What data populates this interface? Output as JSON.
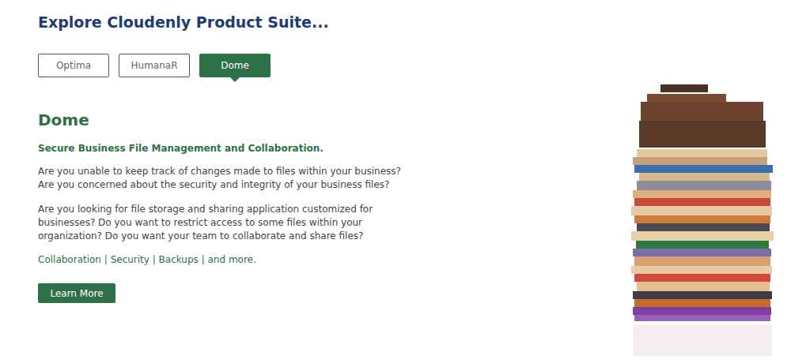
{
  "section": {
    "heading": "Explore Cloudenly Product Suite..."
  },
  "tabs": [
    {
      "label": "Optima",
      "selected": false
    },
    {
      "label": "HumanaR",
      "selected": false
    },
    {
      "label": "Dome",
      "selected": true
    }
  ],
  "product": {
    "title": "Dome",
    "subtitle": "Secure Business File Management and Collaboration.",
    "paragraphs": [
      "Are you unable to keep track of changes made to files within your business? Are you concerned about the security and integrity of your business files?",
      "Are you looking for file storage and sharing application customized for businesses? Do you want to restrict access to some files within your organization? Do you want your team to collaborate and share files?"
    ],
    "tagline": "Collaboration | Security | Backups | and more.",
    "button": "Learn More"
  }
}
